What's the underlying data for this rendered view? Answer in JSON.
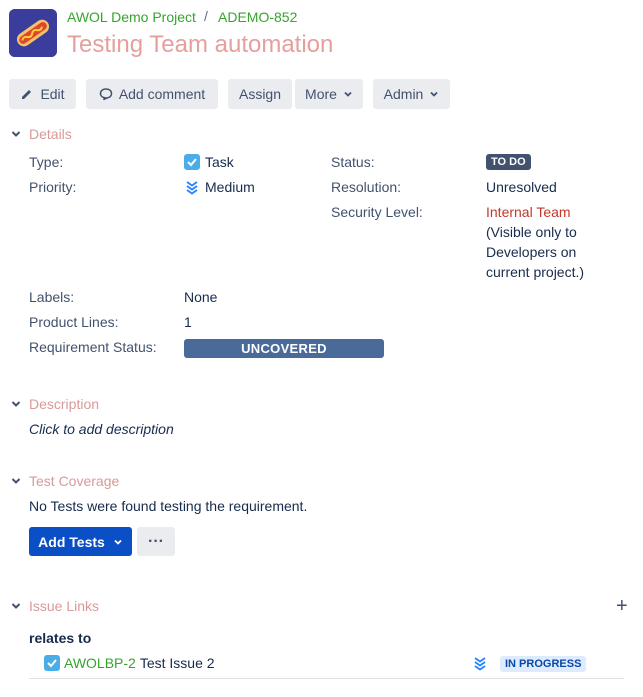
{
  "header": {
    "project": "AWOL Demo Project",
    "separator": "/",
    "issue_key": "ADEMO-852",
    "title": "Testing Team automation"
  },
  "toolbar": {
    "edit": "Edit",
    "add_comment": "Add comment",
    "assign": "Assign",
    "more": "More",
    "admin": "Admin"
  },
  "details": {
    "title": "Details",
    "type_label": "Type:",
    "type_value": "Task",
    "priority_label": "Priority:",
    "priority_value": "Medium",
    "status_label": "Status:",
    "status_value": "TO DO",
    "resolution_label": "Resolution:",
    "resolution_value": "Unresolved",
    "security_label": "Security Level:",
    "security_value": "Internal Team",
    "security_note_1": "(Visible only to",
    "security_note_2": "Developers on",
    "security_note_3": "current project.)",
    "labels_label": "Labels:",
    "labels_value": "None",
    "product_lines_label": "Product Lines:",
    "product_lines_value": "1",
    "requirement_status_label": "Requirement Status:",
    "requirement_status_value": "UNCOVERED"
  },
  "description": {
    "title": "Description",
    "placeholder": "Click to add description"
  },
  "test_coverage": {
    "title": "Test Coverage",
    "message": "No Tests were found testing the requirement.",
    "add_tests": "Add Tests",
    "more": "···"
  },
  "issue_links": {
    "title": "Issue Links",
    "add": "+",
    "relation": "relates to",
    "link_key": "AWOLBP-2",
    "link_summary": "Test Issue 2",
    "link_status": "IN PROGRESS"
  },
  "colors": {
    "accent_green": "#35a52c",
    "title_pink": "#e5a09d",
    "section_pink": "#d89a99",
    "primary_blue": "#0b4fc7",
    "security_red": "#c0392b"
  }
}
